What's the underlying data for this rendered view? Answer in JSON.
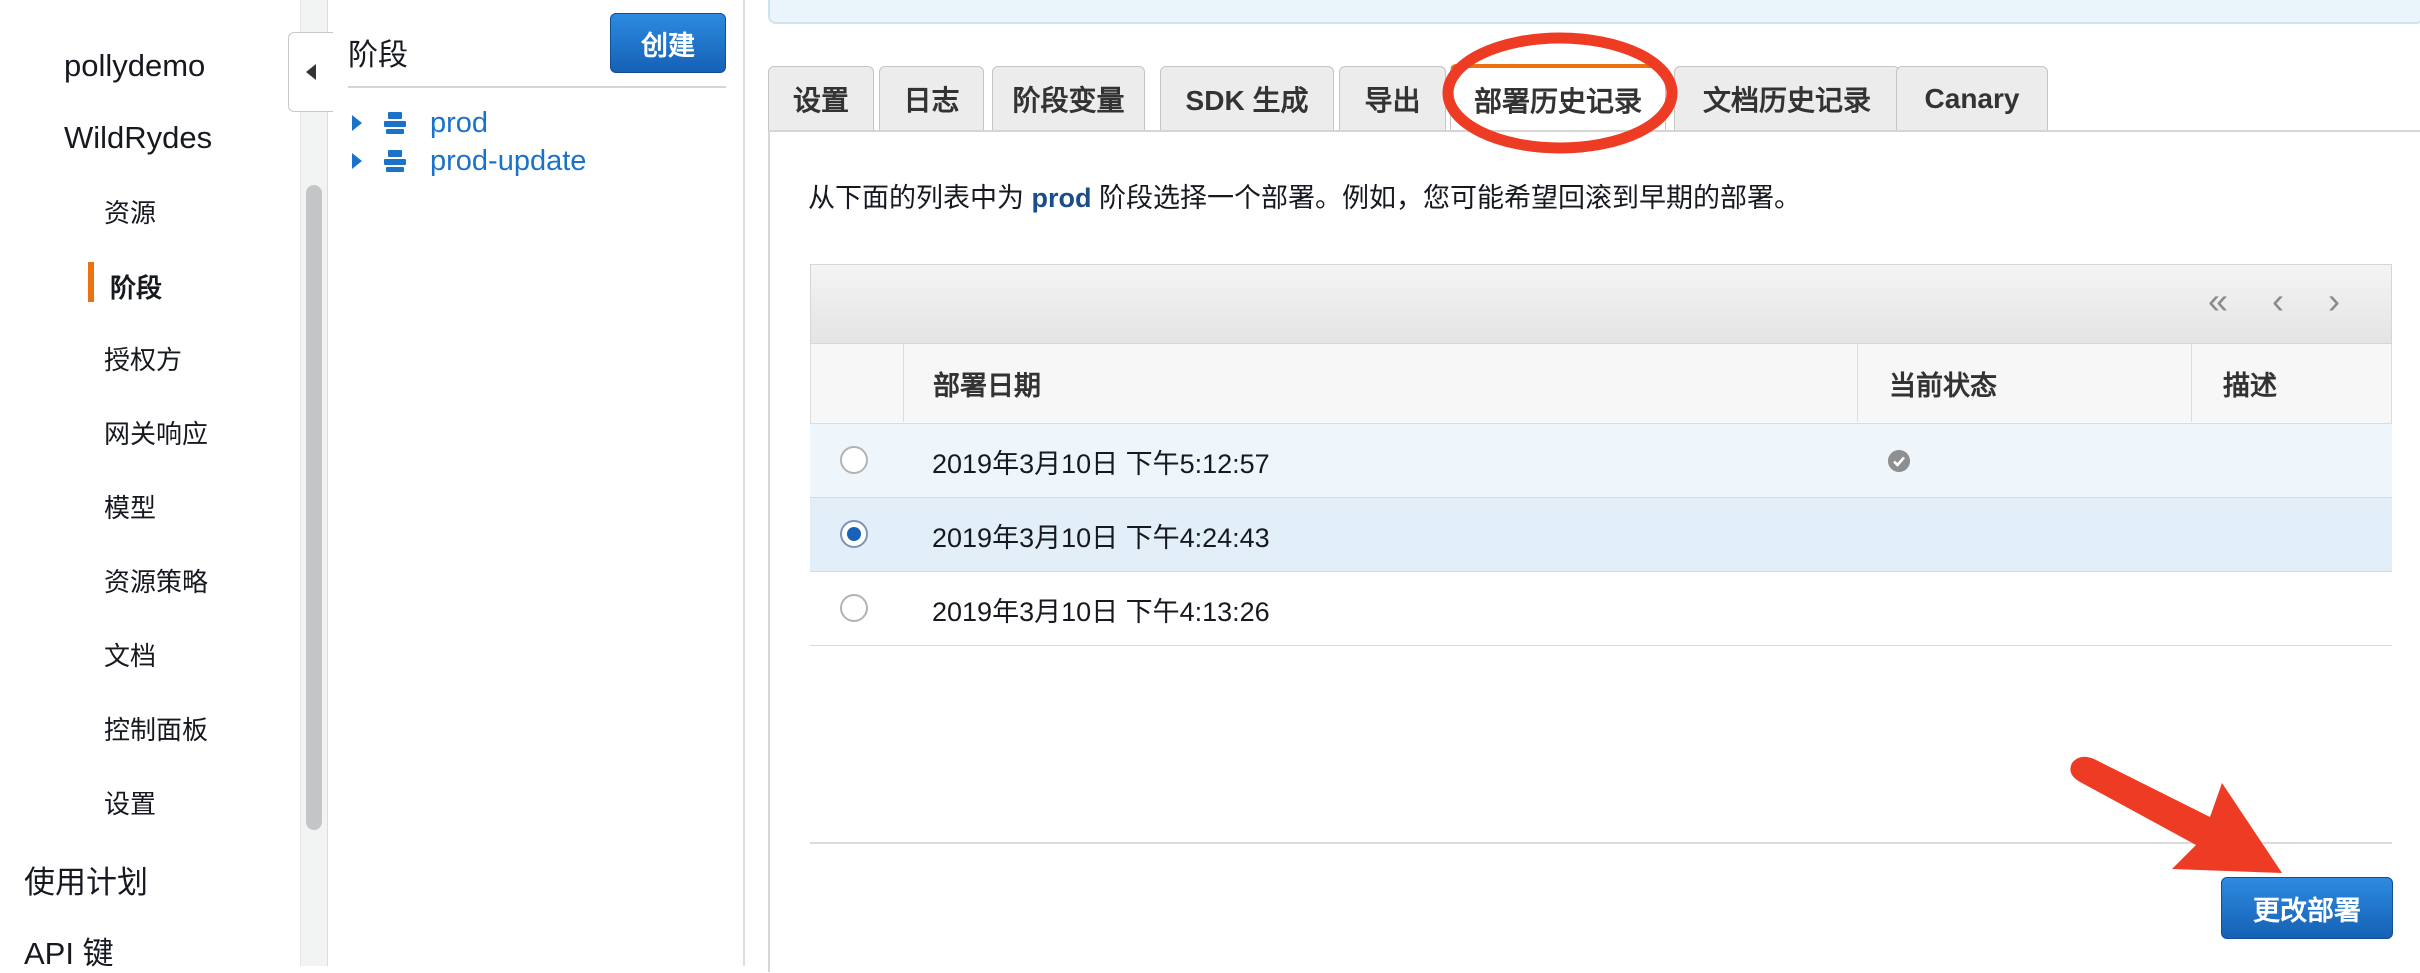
{
  "sidebar": {
    "top_items": [
      "pollydemo",
      "WildRydes"
    ],
    "sub_items": [
      "资源",
      "阶段",
      "授权方",
      "网关响应",
      "模型",
      "资源策略",
      "文档",
      "控制面板",
      "设置"
    ],
    "active_sub_item": "阶段",
    "bottom_items": [
      "使用计划",
      "API 键"
    ]
  },
  "stages_pane": {
    "title": "阶段",
    "create_label": "创建",
    "stages": [
      "prod",
      "prod-update"
    ]
  },
  "tabs": [
    "设置",
    "日志",
    "阶段变量",
    "SDK 生成",
    "导出",
    "部署历史记录",
    "文档历史记录",
    "Canary"
  ],
  "active_tab": "部署历史记录",
  "description": {
    "before": "从下面的列表中为 ",
    "stage": "prod",
    "after": " 阶段选择一个部署。例如，您可能希望回滚到早期的部署。"
  },
  "pager": {
    "first": "«",
    "prev": "‹",
    "next": "›"
  },
  "table": {
    "headers": [
      "部署日期",
      "当前状态",
      "描述"
    ],
    "rows": [
      {
        "date": "2019年3月10日 下午5:12:57",
        "current": true,
        "selected": false
      },
      {
        "date": "2019年3月10日 下午4:24:43",
        "current": false,
        "selected": true
      },
      {
        "date": "2019年3月10日 下午4:13:26",
        "current": false,
        "selected": false
      }
    ]
  },
  "change_deployment_label": "更改部署",
  "colors": {
    "primary_button": "#1b6fc7",
    "link": "#1a73c9",
    "active_accent": "#ec7211",
    "annotation": "#ee3b24",
    "selected_row": "#e2eef8",
    "hover_row": "#eef6fc"
  }
}
